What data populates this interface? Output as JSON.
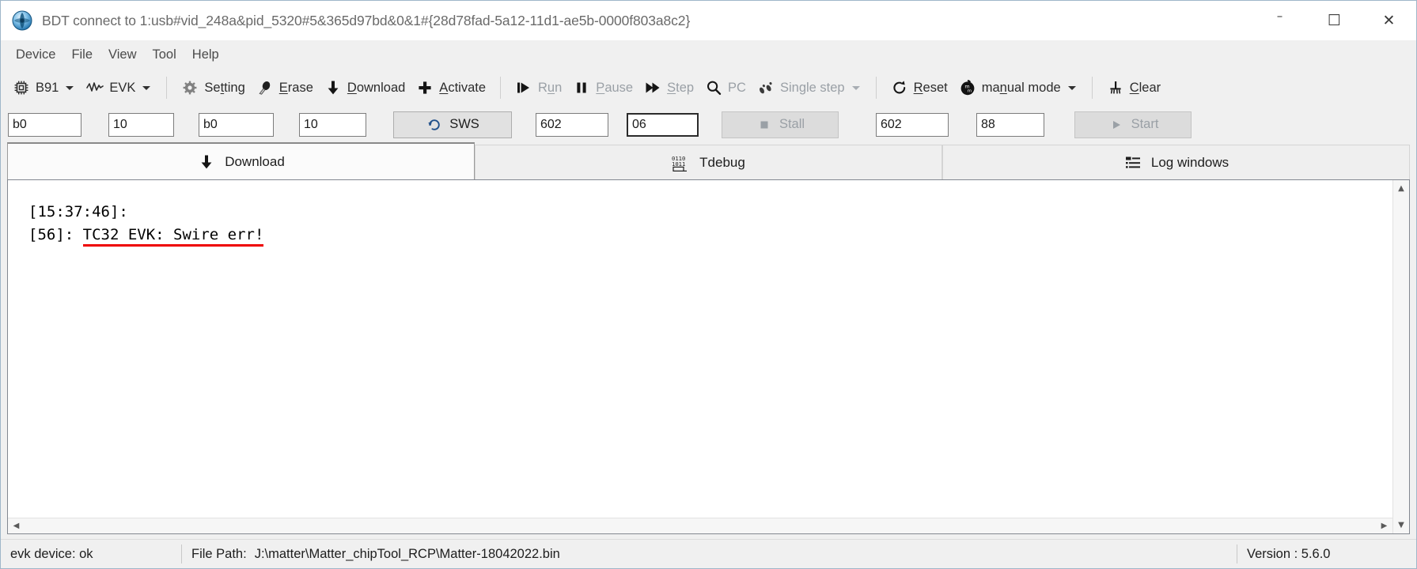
{
  "window": {
    "title": "BDT connect to 1:usb#vid_248a&pid_5320#5&365d97bd&0&1#{28d78fad-5a12-11d1-ae5b-0000f803a8c2}",
    "app_icon": "bdt-app-icon",
    "minimize_label": "–",
    "maximize_label": "☐",
    "close_label": "✕"
  },
  "menubar": {
    "items": [
      {
        "label": "Device",
        "name": "menu-device"
      },
      {
        "label": "File",
        "name": "menu-file"
      },
      {
        "label": "View",
        "name": "menu-view"
      },
      {
        "label": "Tool",
        "name": "menu-tool"
      },
      {
        "label": "Help",
        "name": "menu-help"
      }
    ]
  },
  "toolbar": {
    "chip_selector": {
      "label": "B91",
      "icon": "chip-icon",
      "has_caret": true
    },
    "probe_selector": {
      "label": "EVK",
      "icon": "waveform-icon",
      "has_caret": true
    },
    "setting": {
      "label": "Setting",
      "icon": "gear-icon",
      "accel": "t"
    },
    "erase": {
      "label": "Erase",
      "icon": "eraser-icon",
      "accel": "E"
    },
    "download": {
      "label": "Download",
      "icon": "download-arrow-icon",
      "accel": "D"
    },
    "activate": {
      "label": "Activate",
      "icon": "plus-icon",
      "accel": "A"
    },
    "run": {
      "label": "Run",
      "icon": "play-icon",
      "accel": "u",
      "disabled": true
    },
    "pause": {
      "label": "Pause",
      "icon": "pause-icon",
      "accel": "P",
      "disabled": true
    },
    "step": {
      "label": "Step",
      "icon": "fast-forward-icon",
      "accel": "S",
      "disabled": true
    },
    "pc": {
      "label": "PC",
      "icon": "magnifier-icon",
      "disabled": true
    },
    "single_step": {
      "label": "Single step",
      "icon": "footsteps-icon",
      "has_caret": true,
      "disabled": true
    },
    "reset": {
      "label": "Reset",
      "icon": "refresh-icon",
      "accel": "R"
    },
    "manual_mode": {
      "label": "manual mode",
      "icon": "manual-mode-icon",
      "has_caret": true,
      "accel": "n"
    },
    "clear": {
      "label": "Clear",
      "icon": "clear-icon",
      "accel": "C"
    }
  },
  "fieldrow": {
    "addr1": {
      "value": "b0",
      "placeholder": ""
    },
    "len1": {
      "value": "10",
      "placeholder": ""
    },
    "addr2": {
      "value": "b0",
      "placeholder": ""
    },
    "len2": {
      "value": "10",
      "placeholder": ""
    },
    "sws_button": {
      "label": "SWS",
      "icon": "sws-refresh-icon"
    },
    "stall_addr": {
      "value": "602",
      "placeholder": ""
    },
    "stall_val": {
      "value": "06",
      "placeholder": "",
      "focused": true
    },
    "stall_button": {
      "label": "Stall",
      "icon": "stop-square-icon",
      "disabled": true
    },
    "start_addr": {
      "value": "602",
      "placeholder": ""
    },
    "start_val": {
      "value": "88",
      "placeholder": ""
    },
    "start_button": {
      "label": "Start",
      "icon": "play-triangle-icon",
      "disabled": true
    }
  },
  "tabs": [
    {
      "label": "Download",
      "icon": "download-arrow-icon",
      "active": true,
      "name": "tab-download"
    },
    {
      "label": "Tdebug",
      "icon": "binary-code-icon",
      "active": false,
      "name": "tab-tdebug"
    },
    {
      "label": "Log windows",
      "icon": "list-lines-icon",
      "active": false,
      "name": "tab-log-windows"
    }
  ],
  "log": {
    "line1": "[15:37:46]:",
    "line2_prefix": "[56]: ",
    "line2_error": "TC32 EVK: Swire err!",
    "error_color": "#ee0000",
    "scroll_up": "▲",
    "scroll_down": "▼",
    "scroll_left": "◀",
    "scroll_right": "▶"
  },
  "statusbar": {
    "device_status": "evk device: ok",
    "file_path_label": "File Path:",
    "file_path_value": "J:\\matter\\Matter_chipTool_RCP\\Matter-18042022.bin",
    "version": "Version : 5.6.0"
  }
}
